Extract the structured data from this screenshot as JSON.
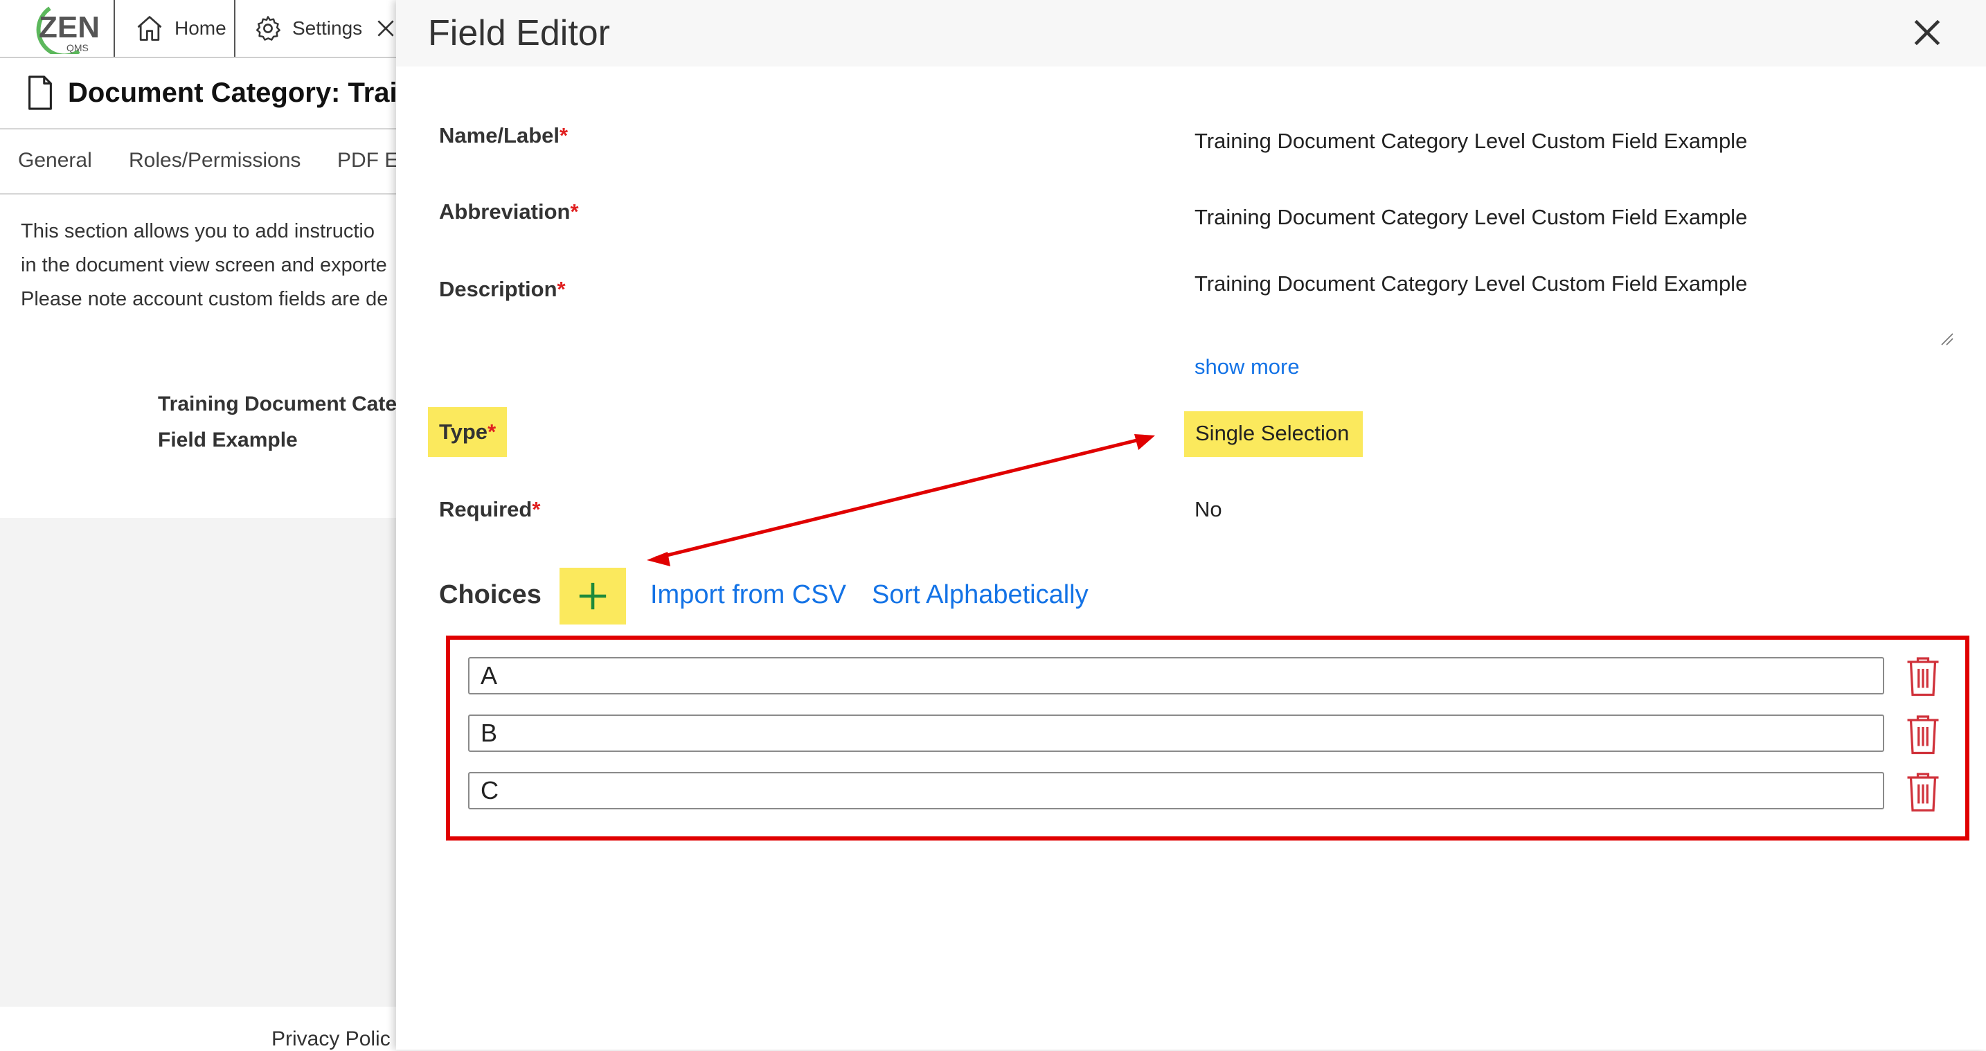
{
  "app": {
    "logo_text": "ZEN",
    "logo_sub": "QMS",
    "nav": {
      "home_label": "Home",
      "settings_label": "Settings"
    },
    "page_title": "Document Category: Traini",
    "tabs": [
      "General",
      "Roles/Permissions",
      "PDF E"
    ],
    "description_lines": [
      "This section allows you to add instructio",
      "in the document view screen and exporte",
      "Please note account custom fields are de"
    ],
    "field_lines": [
      "Training Document Categ",
      "Field Example"
    ],
    "footer_link": "Privacy Polic"
  },
  "field_editor": {
    "title": "Field Editor",
    "fields": {
      "name_label": "Name/Label",
      "name_value": "Training Document Category Level Custom Field Example",
      "abbreviation_label": "Abbreviation",
      "abbreviation_value": "Training Document Category Level Custom Field Example",
      "description_label": "Description",
      "description_value": "Training Document Category Level Custom Field Example",
      "show_more_label": "show more",
      "type_label": "Type",
      "type_value": "Single Selection",
      "required_label": "Required",
      "required_value": "No",
      "required_marker": "*"
    },
    "choices": {
      "label": "Choices",
      "import_label": "Import from CSV",
      "sort_label": "Sort Alphabetically",
      "items": [
        "A",
        "B",
        "C"
      ]
    }
  },
  "colors": {
    "highlight": "#fbe95d",
    "annotation_red": "#e00000",
    "link_blue": "#1473e6",
    "trash_red": "#d0323b",
    "logo_green": "#5cb85c"
  },
  "icons": {
    "logo": "zen-qms-logo",
    "home": "home-icon",
    "settings": "gear-icon",
    "close_tab": "close-icon",
    "document": "document-icon",
    "close_panel": "close-icon",
    "add": "plus-icon",
    "delete": "trash-icon"
  }
}
